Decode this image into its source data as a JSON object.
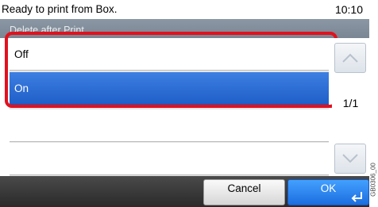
{
  "status": {
    "message": "Ready to print from Box.",
    "time": "10:10"
  },
  "header": {
    "title": "Delete after Print"
  },
  "options": [
    {
      "label": "Off",
      "selected": false
    },
    {
      "label": "On",
      "selected": true
    }
  ],
  "pager": {
    "indicator": "1/1"
  },
  "buttons": {
    "cancel": "Cancel",
    "ok": "OK"
  },
  "caption": "GB0306_00",
  "colors": {
    "accent": "#1f5fc8",
    "highlight": "#e2111d",
    "ok": "#2a86f0"
  }
}
